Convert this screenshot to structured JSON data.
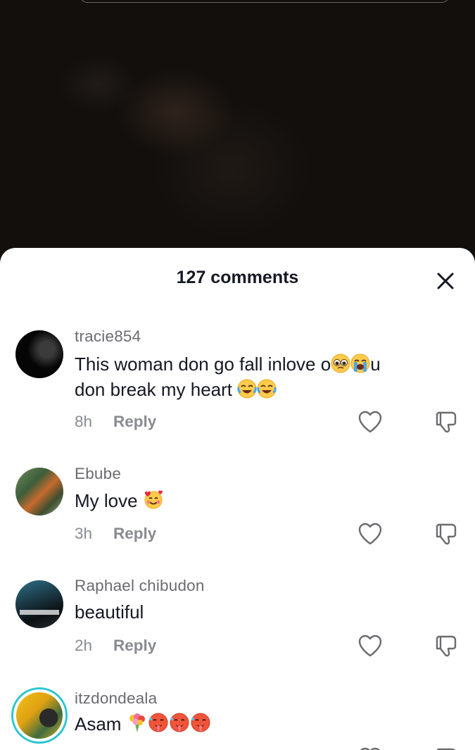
{
  "header": {
    "title": "127 comments",
    "close_icon": "close-icon"
  },
  "comments": [
    {
      "username": "tracie854",
      "text_parts": [
        "This woman don go fall inlove o",
        "u",
        "don break my heart "
      ],
      "emojis": [
        "pleading-face",
        "loudly-crying-face",
        "face-with-tears-of-joy",
        "face-with-tears-of-joy"
      ],
      "time": "8h",
      "reply": "Reply"
    },
    {
      "username": "Ebube",
      "text_parts": [
        "My love "
      ],
      "emojis": [
        "smiling-face-with-hearts"
      ],
      "time": "3h",
      "reply": "Reply"
    },
    {
      "username": "Raphael chibudon",
      "text_parts": [
        "beautiful"
      ],
      "emojis": [],
      "time": "2h",
      "reply": "Reply"
    },
    {
      "username": "itzdondeala",
      "text_parts": [
        "Asam "
      ],
      "emojis": [
        "bouquet",
        "hot-face",
        "hot-face",
        "hot-face"
      ],
      "time": "",
      "reply": ""
    }
  ],
  "colors": {
    "sheet_bg": "#ffffff",
    "text_primary": "#161823",
    "text_secondary": "#8a8b91",
    "story_ring": "#2fc6d1"
  }
}
